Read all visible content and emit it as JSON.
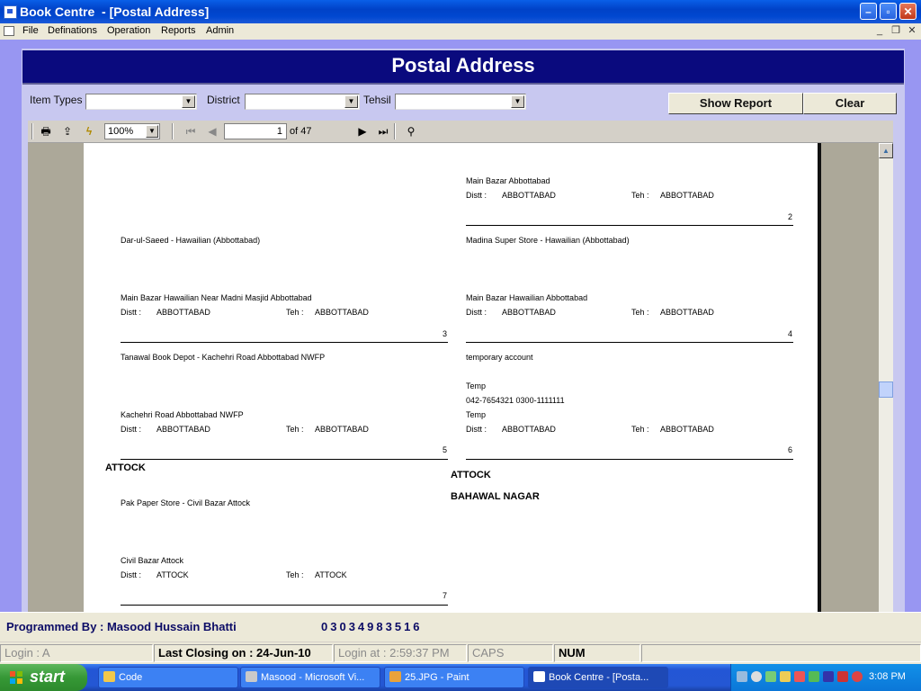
{
  "window": {
    "title": "Book Centre  - [Postal Address]"
  },
  "menu": {
    "items": [
      "File",
      "Definations",
      "Operation",
      "Reports",
      "Admin"
    ]
  },
  "form": {
    "title": "Postal Address",
    "filters": {
      "item_types_label": "Item Types",
      "district_label": "District",
      "tehsil_label": "Tehsil"
    },
    "show_report_label": "Show Report",
    "clear_label": "Clear"
  },
  "viewer": {
    "zoom": "100%",
    "page": "1",
    "page_total": "of 47"
  },
  "report": {
    "distt_label": "Distt :",
    "teh_label": "Teh :",
    "entries": [
      {
        "id": 2,
        "name": "",
        "address": "Main Bazar Abbottabad",
        "distt": "ABBOTTABAD",
        "teh": "ABBOTTABAD"
      },
      {
        "id": 3,
        "name": "Dar-ul-Saeed - Hawailian (Abbottabad)",
        "address": "Main Bazar Hawailian Near Madni Masjid Abbottabad",
        "distt": "ABBOTTABAD",
        "teh": "ABBOTTABAD"
      },
      {
        "id": 4,
        "name": "Madina Super Store - Hawailian (Abbottabad)",
        "address": "Main Bazar Hawailian Abbottabad",
        "distt": "ABBOTTABAD",
        "teh": "ABBOTTABAD"
      },
      {
        "id": 5,
        "name": "Tanawal Book Depot - Kachehri Road Abbottabad NWFP",
        "address": "Kachehri Road Abbottabad NWFP",
        "distt": "ABBOTTABAD",
        "teh": "ABBOTTABAD"
      },
      {
        "id": 6,
        "name": "temporary account",
        "extra1": "Temp",
        "extra2": "042-7654321  0300-1111111",
        "address": "Temp",
        "distt": "ABBOTTABAD",
        "teh": "ABBOTTABAD"
      },
      {
        "id": 7,
        "name": "Pak Paper Store - Civil Bazar Attock",
        "address": "Civil Bazar Attock",
        "distt": "ATTOCK",
        "teh": "ATTOCK"
      }
    ],
    "group_headers": [
      "ATTOCK",
      "ATTOCK",
      "BAHAWAL NAGAR"
    ]
  },
  "info": {
    "programmed_by": "Programmed By : Masood Hussain Bhatti",
    "phone": "03034983516"
  },
  "status": {
    "login": "Login :  A",
    "last_closing": "Last Closing on : 24-Jun-10",
    "login_at": "Login at : 2:59:37 PM",
    "caps": "CAPS",
    "num": "NUM"
  },
  "taskbar": {
    "start_label": "start",
    "tasks": [
      "Code",
      "Masood - Microsoft Vi...",
      "25.JPG - Paint",
      "Book Centre  - [Posta..."
    ],
    "clock": "3:08 PM"
  },
  "colors": {
    "header_bg": "#0a0a7e",
    "mdi_bg": "#9896f2",
    "title_blue": "#0042c8"
  }
}
